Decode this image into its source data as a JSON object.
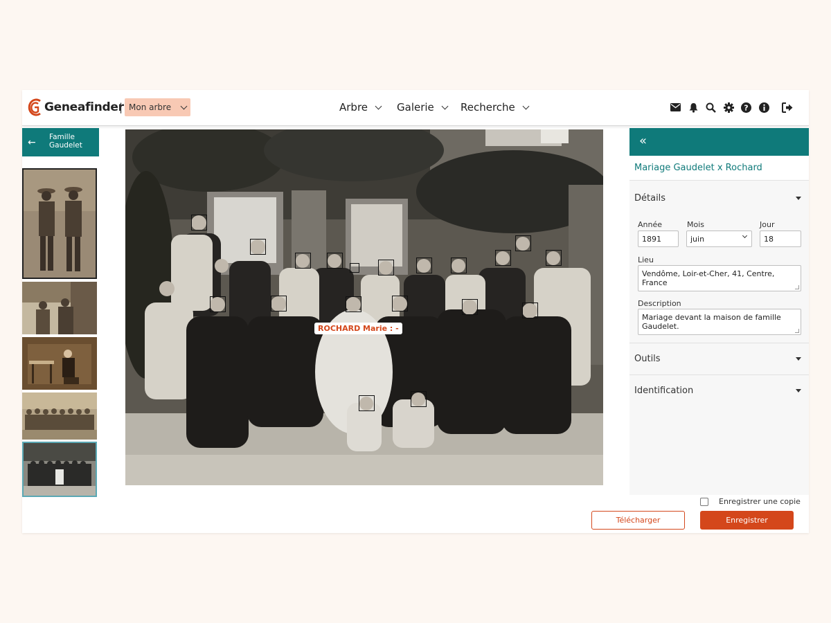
{
  "header": {
    "brand": "Geneafinder",
    "separator": "|",
    "tree_selector": "Mon arbre",
    "nav": [
      {
        "label": "Arbre"
      },
      {
        "label": "Galerie"
      },
      {
        "label": "Recherche"
      }
    ],
    "icons": [
      "envelope-icon",
      "bell-icon",
      "search-icon",
      "gear-icon",
      "help-icon",
      "info-icon",
      "logout-icon"
    ]
  },
  "gallery": {
    "back_label": "Famille Gaudelet",
    "thumbnails": [
      "soldiers",
      "children-porch",
      "man-seated-interior",
      "group-soldiers",
      "wedding-group"
    ]
  },
  "photo": {
    "face_tag": "ROCHARD Marie : -"
  },
  "details_panel": {
    "title": "Mariage Gaudelet x Rochard",
    "details_header": "Détails",
    "year_label": "Année",
    "year_value": "1891",
    "month_label": "Mois",
    "month_value": "juin",
    "day_label": "Jour",
    "day_value": "18",
    "place_label": "Lieu",
    "place_value": "Vendôme, Loir-et-Cher, 41, Centre, France",
    "description_label": "Description",
    "description_value": "Mariage devant la maison de famille Gaudelet.",
    "tools_header": "Outils",
    "identification_header": "Identification"
  },
  "footer": {
    "save_copy_label": "Enregistrer une copie",
    "download_label": "Télécharger",
    "save_label": "Enregistrer"
  },
  "colors": {
    "accent": "#0f7a7a",
    "brand_orange": "#d4471b",
    "tree_selector_bg": "#f8c9b4",
    "page_bg": "#fdf7f2"
  }
}
